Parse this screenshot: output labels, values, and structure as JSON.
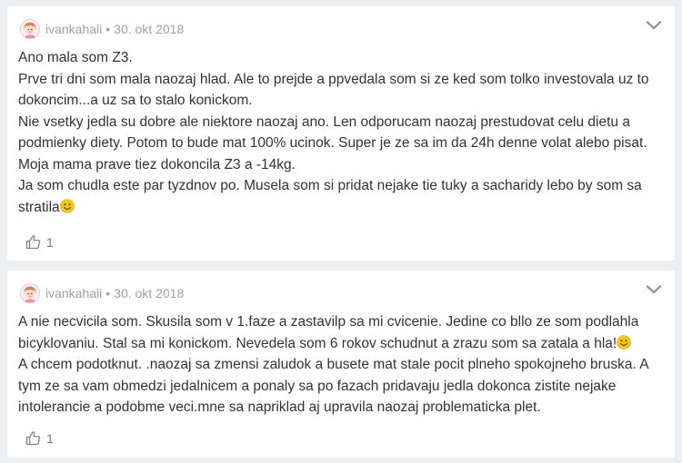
{
  "comments": [
    {
      "author": "ivankahali",
      "separator": "•",
      "date": "30. okt 2018",
      "avatar_icon": "girl-avatar-icon",
      "lines": [
        "Ano mala som Z3.",
        "Prve tri dni som mala naozaj hlad. Ale to prejde a ppvedala som si ze ked som tolko investovala uz to dokoncim...a uz sa to stalo konickom.",
        "Nie vsetky jedla su dobre ale niektore naozaj ano. Len odporucam naozaj prestudovat celu dietu a podmienky diety. Potom to bude mat 100% ucinok. Super je ze sa im da 24h denne volat alebo pisat. Moja mama prave tiez dokoncila Z3 a -14kg.",
        "Ja som chudla este par tyzdnov po. Musela som si pridat nejake tie tuky a sacharidy lebo by som sa stratila"
      ],
      "likes": "1"
    },
    {
      "author": "ivankahali",
      "separator": "•",
      "date": "30. okt 2018",
      "avatar_icon": "girl-avatar-icon",
      "lines": [
        "A nie necvicila som. Skusila som v 1.faze a zastavilp sa mi cvicenie. Jedine co bllo ze som podlahla bicyklovaniu. Stal sa mi konickom. Nevedela som 6 rokov schudnut a zrazu som sa zatala a hla!",
        "A chcem podotknut. .naozaj sa zmensi zaludok a busete mat stale pocit plneho spokojneho bruska. A tym ze sa vam obmedzi jedalnicem a ponaly sa po fazach pridavaju jedla dokonca zistite nejake intolerancie a podobme veci.mne sa napriklad aj upravila naozaj problematicka plet."
      ],
      "likes": "1"
    }
  ],
  "colors": {
    "background": "#eceff2",
    "card": "#ffffff",
    "meta_text": "#9aa1a8",
    "body_text": "#333333",
    "smiley": "#f5c518"
  }
}
